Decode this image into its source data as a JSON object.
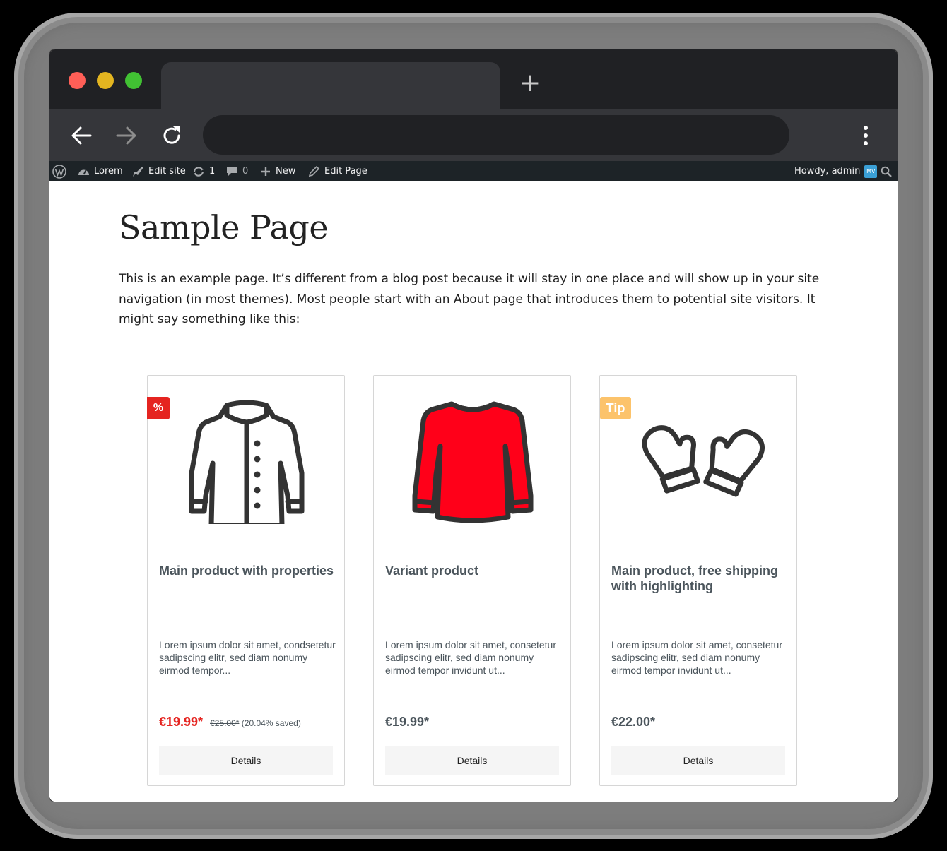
{
  "browser": {
    "new_tab_glyph": "+"
  },
  "adminbar": {
    "site_name": "Lorem",
    "edit_site": "Edit site",
    "updates_count": "1",
    "comments_count": "0",
    "new_label": "New",
    "edit_page": "Edit Page",
    "greeting": "Howdy, admin",
    "avatar_initials": "MV"
  },
  "page": {
    "title": "Sample Page",
    "intro": "This is an example page. It’s different from a blog post because it will stay in one place and will show up in your site navigation (in most themes). Most people start with an About page that introduces them to potential site visitors. It might say something like this:"
  },
  "products": [
    {
      "badge": "%",
      "name": "Main product with properties",
      "description": "Lorem ipsum dolor sit amet, condsetetur sadipscing elitr, sed diam nonumy eirmod tempor...",
      "price": "€19.99*",
      "old_price": "€25.00*",
      "saved": "(20.04% saved)",
      "button": "Details",
      "image_icon": "jacket-icon"
    },
    {
      "badge": "",
      "name": "Variant product",
      "description": "Lorem ipsum dolor sit amet, consetetur sadipscing elitr, sed diam nonumy eirmod tempor invidunt ut...",
      "price": "€19.99*",
      "button": "Details",
      "image_icon": "sweater-icon"
    },
    {
      "badge": "Tip",
      "name": "Main product, free shipping with highlighting",
      "description": "Lorem ipsum dolor sit amet, consetetur sadipscing elitr, sed diam nonumy eirmod tempor invidunt ut...",
      "price": "€22.00*",
      "button": "Details",
      "image_icon": "mittens-icon"
    }
  ],
  "colors": {
    "sale_red": "#e52420",
    "tip_orange": "#fcc36b",
    "sweater_red": "#ff0019",
    "admin_bar": "#1d2327"
  }
}
